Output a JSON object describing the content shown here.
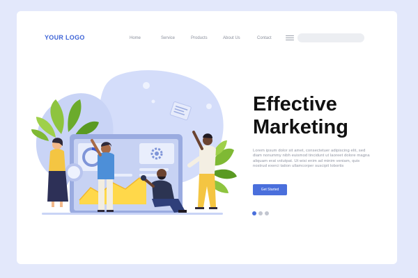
{
  "logo": {
    "text": "YOUR LOGO"
  },
  "nav": {
    "items": [
      "Home",
      "Service",
      "Products",
      "About Us",
      "Contact"
    ]
  },
  "icons": {
    "menu": "hamburger-menu-icon",
    "gear": "gear-icon",
    "document": "document-icon"
  },
  "hero": {
    "title_line1": "Effective",
    "title_line2": "Marketing",
    "description": "Lorem ipsum dolor sit amet, consectetuer adipiscing elit, sed diam nonummy nibh euismod tincidunt ut laoreet dolore magna aliquam erat volutpat. Ut wisi enim ad minim veniam, quis nostrud exerci tation ullamcorper suscipit lobortis",
    "cta_label": "Get Started"
  },
  "carousel": {
    "count": 3,
    "active": 1
  },
  "colors": {
    "page_bg": "#e3e8fb",
    "accent": "#4a6fdc",
    "logo": "#3d63d6",
    "dot_active": "#4a6fdc",
    "dot_inactive": "#c2c6d0"
  }
}
